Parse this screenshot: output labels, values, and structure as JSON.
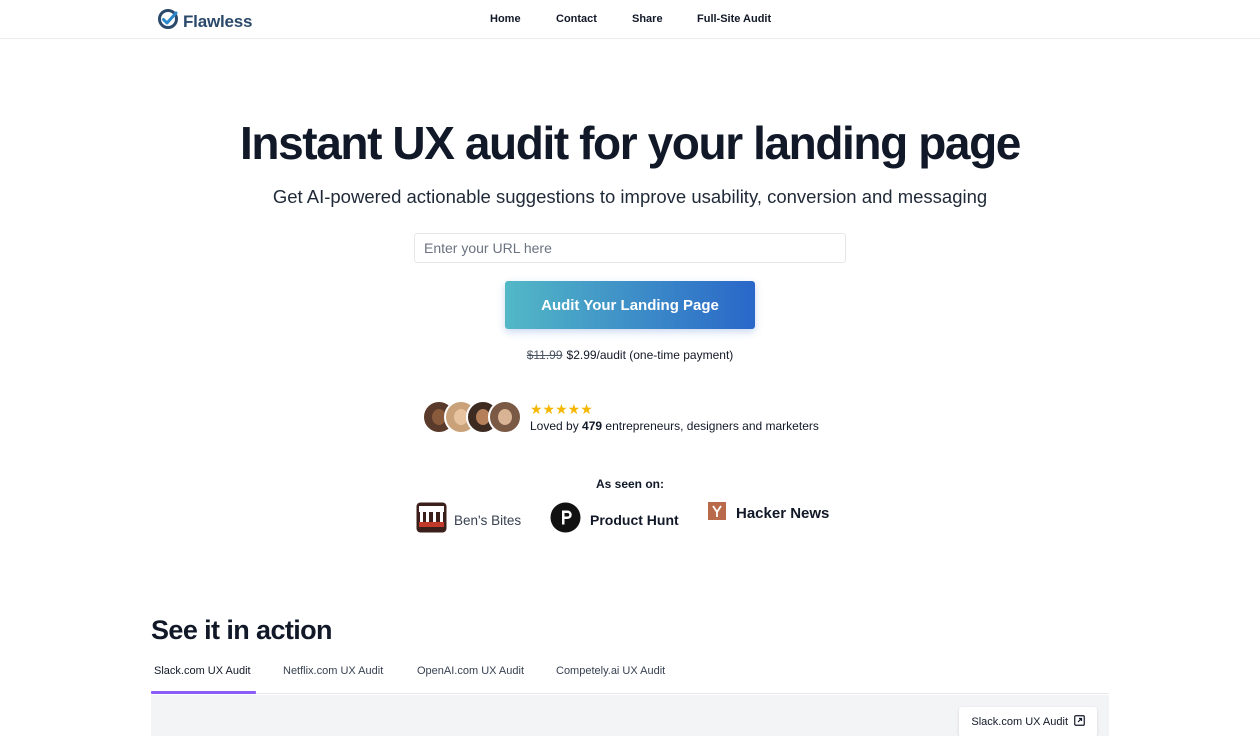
{
  "nav": {
    "logo_text": "Flawless",
    "links": [
      "Home",
      "Contact",
      "Share",
      "Full-Site Audit"
    ]
  },
  "hero": {
    "title": "Instant UX audit for your landing page",
    "subtitle": "Get AI-powered actionable suggestions to improve usability, conversion and messaging",
    "url_placeholder": "Enter your URL here",
    "cta_label": "Audit Your Landing Page",
    "price_old": "$11.99",
    "price_new": "$2.99/audit (one-time payment)"
  },
  "social_proof": {
    "stars": "★★★★★",
    "loved_prefix": "Loved by ",
    "count": "479",
    "loved_suffix": " entrepreneurs, designers and marketers"
  },
  "as_seen_on": {
    "label": "As seen on:",
    "brands": [
      "Ben's Bites",
      "Product Hunt",
      "Hacker News"
    ]
  },
  "demo": {
    "title": "See it in action",
    "tabs": [
      "Slack.com UX Audit",
      "Netflix.com UX Audit",
      "OpenAI.com UX Audit",
      "Competely.ai UX Audit"
    ],
    "active_tab": 0,
    "preview_chip": "Slack.com UX Audit"
  },
  "colors": {
    "cta_gradient_start": "#52b8c6",
    "cta_gradient_end": "#2a67c9",
    "tab_underline": "#8b5cf6",
    "stars": "#f5b700",
    "logo": "#2b4a6b"
  }
}
